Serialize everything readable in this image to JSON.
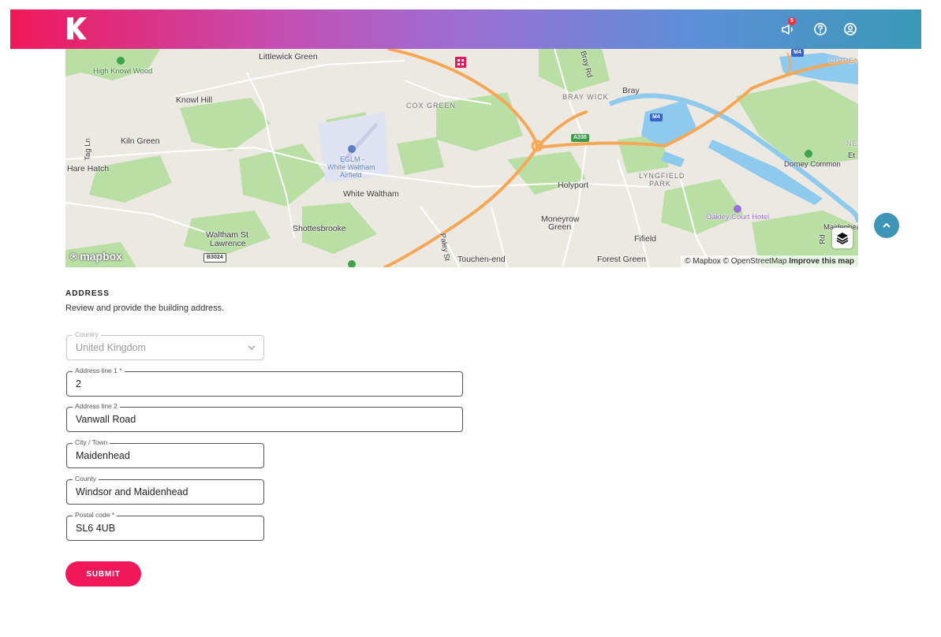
{
  "header": {
    "logo_icon": "k-logo-icon",
    "notification_count": "5",
    "icons": [
      "announcement-icon",
      "help-icon",
      "account-icon"
    ],
    "gradient": [
      "#f0185a",
      "#3a98b6"
    ]
  },
  "map": {
    "places": {
      "high_knowl_wood": "High Knowl Wood",
      "littlewick_green": "Littlewick Green",
      "knowl_hill": "Knowl Hill",
      "cox_green": "COX GREEN",
      "bray_wick": "BRAY WICK",
      "bray": "Bray",
      "bray_rd": "Bray Rd",
      "cippen": "CIPPEN",
      "kiln_green": "Kiln Green",
      "tag_ln": "Tag Ln",
      "hare_hatch": "Hare Hatch",
      "eglm": "EGLM -",
      "white_waltham_airfield_1": "White Waltham",
      "white_waltham_airfield_2": "Airfield",
      "white_waltham": "White Waltham",
      "holyport": "Holyport",
      "lyngfield_park_1": "LYNGFIELD",
      "lyngfield_park_2": "PARK",
      "dorney_common": "Dorney Common",
      "et": "Et",
      "new": "NEV",
      "moneyrow_green_1": "Moneyrow",
      "moneyrow_green_2": "Green",
      "oakley_court_hotel": "Oakley Court Hotel",
      "waltham_st_lawrence_1": "Waltham St",
      "waltham_st_lawrence_2": "Lawrence",
      "shottesbrooke": "Shottesbrooke",
      "fifield": "Fifield",
      "paley_st": "Paley St",
      "touchen_end": "Touchen-end",
      "forest_green": "Forest Green",
      "maidenhead_edge": "Maidenhea",
      "rd_edge": "Rd"
    },
    "road_shields": {
      "a330": "A330",
      "m4a": "M4",
      "m4b": "M4",
      "b3024": "B3024"
    },
    "mapbox_logo": "mapbox",
    "attribution": "© Mapbox © OpenStreetMap",
    "improve_link": "Improve this map",
    "layers_icon": "layers-icon",
    "colors": {
      "land": "#ece8e2",
      "green": "#b9dfa4",
      "water": "#8ec9ee",
      "motorway": "#f7a857"
    }
  },
  "scroll_top": {
    "icon": "chevron-up-icon",
    "color": "#3f95b8"
  },
  "address": {
    "title": "ADDRESS",
    "description": "Review and provide the building address.",
    "fields": {
      "country": {
        "label": "Country",
        "value": "United Kingdom"
      },
      "line1": {
        "label": "Address line 1 *",
        "value": "2"
      },
      "line2": {
        "label": "Address line 2",
        "value": "Vanwall Road"
      },
      "city": {
        "label": "City / Town",
        "value": "Maidenhead"
      },
      "county": {
        "label": "County",
        "value": "Windsor and Maidenhead"
      },
      "postal": {
        "label": "Postal code *",
        "value": "SL6 4UB"
      }
    },
    "submit_label": "SUBMIT",
    "accent": "#f0185a"
  }
}
